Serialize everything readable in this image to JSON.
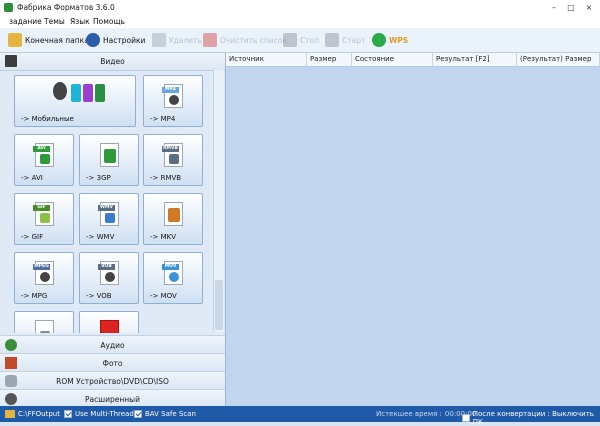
{
  "window": {
    "title": "Фабрика Форматов 3.6.0",
    "min": "–",
    "max": "□",
    "close": "×"
  },
  "menu": [
    "задание",
    "Темы",
    "Язык",
    "Помощь"
  ],
  "toolbar": {
    "output_folder": "Конечная папка",
    "settings": "Настройки",
    "btn3": "Удалить",
    "btn4": "Очистить список",
    "btn5": "Стоп",
    "btn6": "Старт",
    "wps": "WPS"
  },
  "categories": {
    "video": "Видео",
    "audio": "Аудио",
    "photo": "Фото",
    "rom": "ROM Устройство\\DVD\\CD\\ISO",
    "advanced": "Расширенный"
  },
  "video_tiles": [
    {
      "label": "-> Мобильные",
      "tag": "",
      "color": "#3a7bd5"
    },
    {
      "label": "-> MP4",
      "tag": "MP4",
      "color": "#6aa6de"
    },
    {
      "label": "-> AVI",
      "tag": "AVI",
      "color": "#2e9b3b"
    },
    {
      "label": "-> 3GP",
      "tag": "",
      "color": "#2e9b3b"
    },
    {
      "label": "-> RMVB",
      "tag": "RMVB",
      "color": "#5a6f86"
    },
    {
      "label": "-> GIF",
      "tag": "GIF",
      "color": "#4b8a2e"
    },
    {
      "label": "-> WMV",
      "tag": "WMV",
      "color": "#5a6f86"
    },
    {
      "label": "-> MKV",
      "tag": "",
      "color": "#d07a27"
    },
    {
      "label": "-> MPG",
      "tag": "MPEG",
      "color": "#4f6fa3"
    },
    {
      "label": "-> VOB",
      "tag": "VOB",
      "color": "#5a6f86"
    },
    {
      "label": "-> MOV",
      "tag": "MOV",
      "color": "#3a93d6"
    },
    {
      "label": "",
      "tag": "",
      "color": "#8a8a8a"
    },
    {
      "label": "",
      "tag": "",
      "color": "#d22"
    }
  ],
  "table": {
    "columns": [
      "Источник",
      "Размер",
      "Состояние",
      "Результат [F2]",
      "(Результат) Размер"
    ]
  },
  "statusbar": {
    "path": "C:\\FFOutput",
    "multithread": "Use Multi-Threads",
    "safescan": "BAV Safe Scan",
    "elapsed_label": "Истекшее время :",
    "elapsed": "00:00:00",
    "after_convert": "После конвертации : Выключить ПК"
  }
}
